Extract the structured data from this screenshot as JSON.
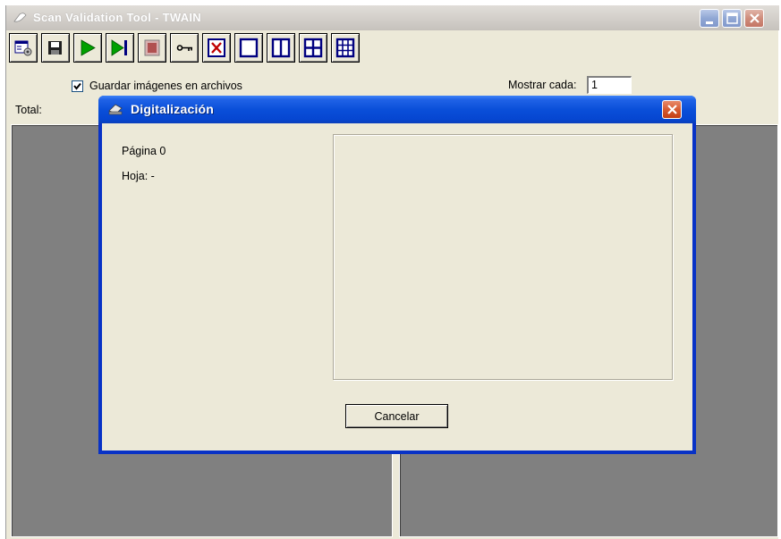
{
  "main_window": {
    "title": "Scan Validation Tool - TWAIN",
    "caption_buttons": [
      "minimize-icon",
      "maximize-icon",
      "close-icon"
    ]
  },
  "toolbar": {
    "buttons": [
      {
        "name": "settings-button",
        "icon": "scanner-settings-icon"
      },
      {
        "name": "save-button",
        "icon": "floppy-disk-icon"
      },
      {
        "name": "start-scan-button",
        "icon": "play-icon"
      },
      {
        "name": "scan-one-button",
        "icon": "play-to-end-icon"
      },
      {
        "name": "stop-button",
        "icon": "stop-icon"
      },
      {
        "name": "license-key-button",
        "icon": "key-icon"
      },
      {
        "name": "no-view-button",
        "icon": "x-box-icon"
      },
      {
        "name": "view-1-button",
        "icon": "single-pane-icon"
      },
      {
        "name": "view-2-button",
        "icon": "two-pane-icon"
      },
      {
        "name": "view-4-button",
        "icon": "four-pane-icon"
      },
      {
        "name": "view-many-button",
        "icon": "grid-pane-icon"
      }
    ],
    "accent_green": "#00a000",
    "accent_blue": "#000080",
    "accent_red": "#c00000"
  },
  "options": {
    "save_images_label": "Guardar imágenes en archivos",
    "save_images_checked": true,
    "show_every_label": "Mostrar cada:",
    "show_every_value": "1",
    "total_label": "Total:"
  },
  "dialog": {
    "title": "Digitalización",
    "page_label": "Página 0",
    "sheet_label": "Hoja: -",
    "cancel_label": "Cancelar",
    "title_color": "#0a4fd9"
  }
}
